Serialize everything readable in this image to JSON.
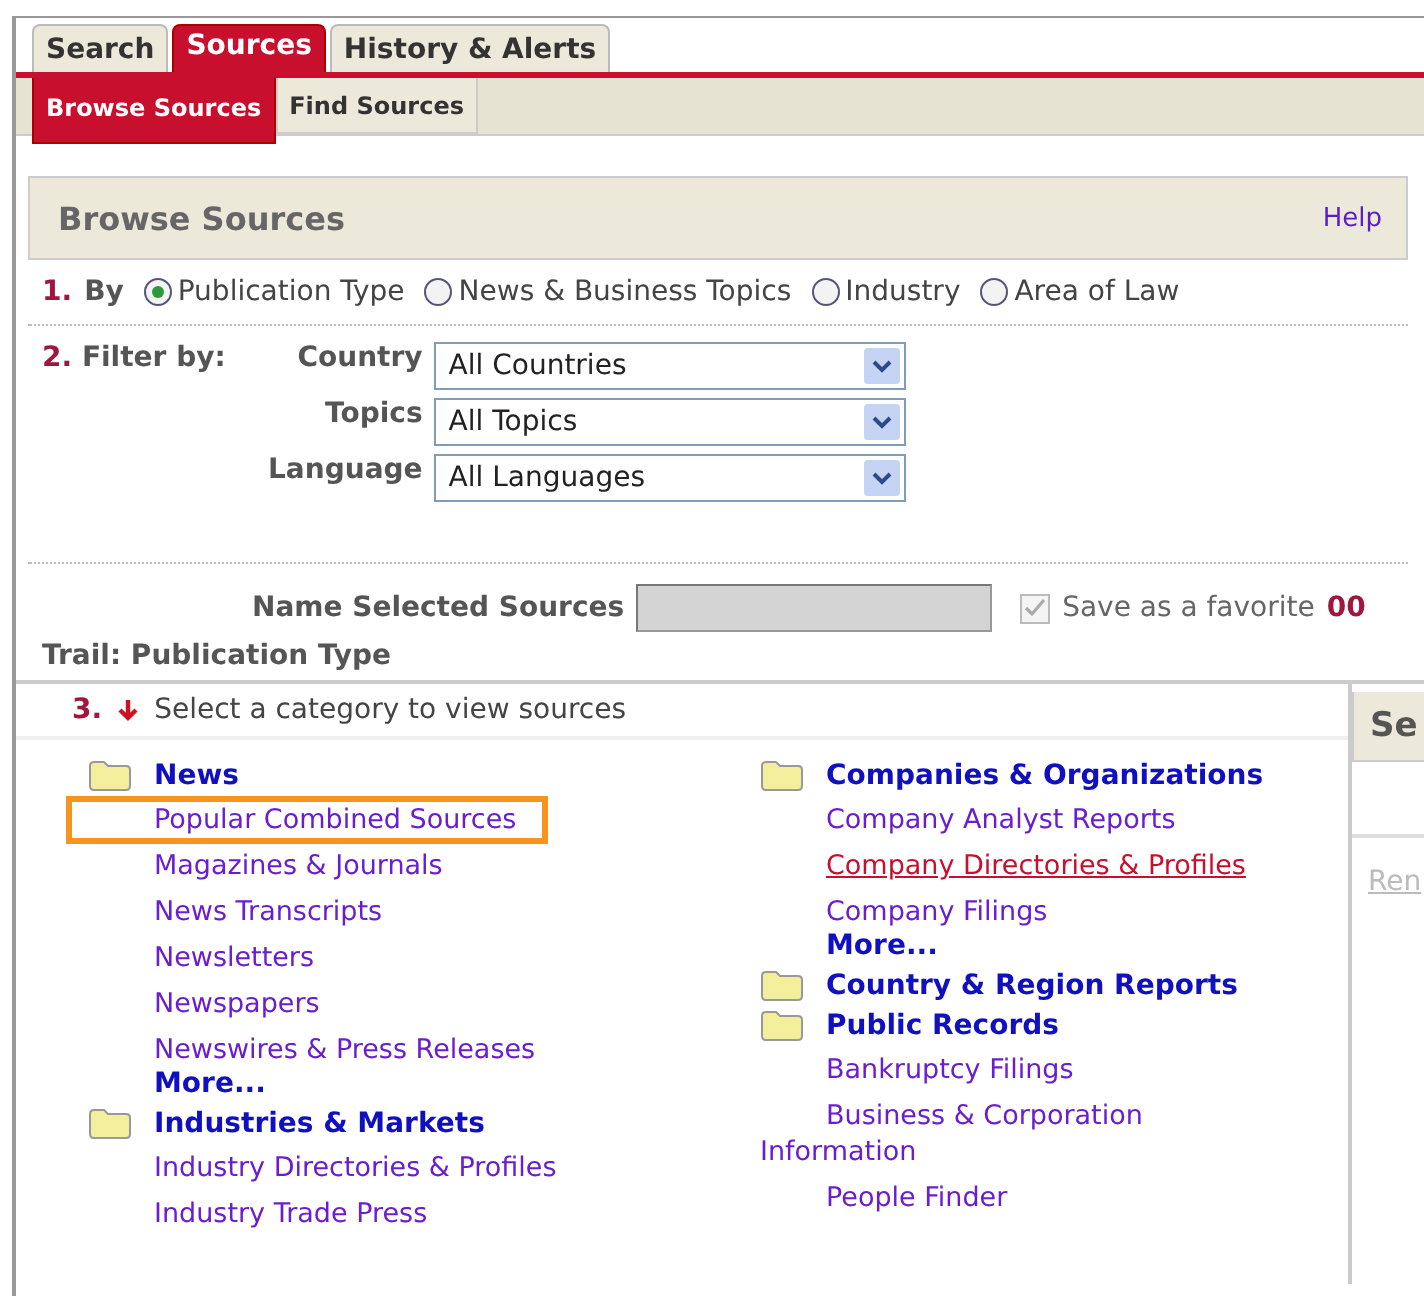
{
  "tabs": [
    {
      "label": "Search",
      "selected": false
    },
    {
      "label": "Sources",
      "selected": true
    },
    {
      "label": "History & Alerts",
      "selected": false
    }
  ],
  "subtabs": [
    {
      "label": "Browse Sources",
      "selected": true
    },
    {
      "label": "Find Sources",
      "selected": false
    }
  ],
  "panel": {
    "title": "Browse Sources",
    "help": "Help"
  },
  "step1": {
    "number": "1.",
    "label": "By",
    "options": [
      {
        "label": "Publication Type",
        "selected": true
      },
      {
        "label": "News & Business Topics",
        "selected": false
      },
      {
        "label": "Industry",
        "selected": false
      },
      {
        "label": "Area of Law",
        "selected": false
      }
    ]
  },
  "step2": {
    "number": "2.",
    "label": "Filter by:",
    "filters": [
      {
        "label": "Country",
        "value": "All Countries"
      },
      {
        "label": "Topics",
        "value": "All Topics"
      },
      {
        "label": "Language",
        "value": "All Languages"
      }
    ]
  },
  "name_row": {
    "label": "Name Selected Sources",
    "checkbox": {
      "label": "Save as a favorite",
      "checked": true,
      "disabled": true
    },
    "count": "00"
  },
  "trail": "Trail: Publication Type",
  "step3": {
    "number": "3.",
    "instruction": "Select a category to view sources"
  },
  "columns": [
    {
      "categories": [
        {
          "title": "News",
          "items": [
            {
              "label": "Popular Combined Sources",
              "highlighted": true,
              "hovered": false
            },
            {
              "label": "Magazines & Journals",
              "highlighted": false,
              "hovered": false
            },
            {
              "label": "News Transcripts",
              "highlighted": false,
              "hovered": false
            },
            {
              "label": "Newsletters",
              "highlighted": false,
              "hovered": false
            },
            {
              "label": "Newspapers",
              "highlighted": false,
              "hovered": false
            },
            {
              "label": "Newswires & Press Releases",
              "highlighted": false,
              "hovered": false
            }
          ],
          "more": "More..."
        },
        {
          "title": "Industries & Markets",
          "items": [
            {
              "label": "Industry Directories & Profiles",
              "highlighted": false,
              "hovered": false
            },
            {
              "label": "Industry Trade Press",
              "highlighted": false,
              "hovered": false
            }
          ]
        }
      ]
    },
    {
      "categories": [
        {
          "title": "Companies & Organizations",
          "items": [
            {
              "label": "Company Analyst Reports",
              "highlighted": false,
              "hovered": false
            },
            {
              "label": "Company Directories & Profiles",
              "highlighted": false,
              "hovered": true
            },
            {
              "label": "Company Filings",
              "highlighted": false,
              "hovered": false
            }
          ],
          "more": "More..."
        },
        {
          "title": "Country & Region Reports"
        },
        {
          "title": "Public Records",
          "items": [
            {
              "label": "Bankruptcy Filings",
              "highlighted": false,
              "hovered": false
            },
            {
              "label": "Business & Corporation Information",
              "highlighted": false,
              "hovered": false
            },
            {
              "label": "People Finder",
              "highlighted": false,
              "hovered": false
            }
          ]
        }
      ]
    }
  ],
  "side_panel": {
    "title": "Se",
    "link": "Ren"
  }
}
